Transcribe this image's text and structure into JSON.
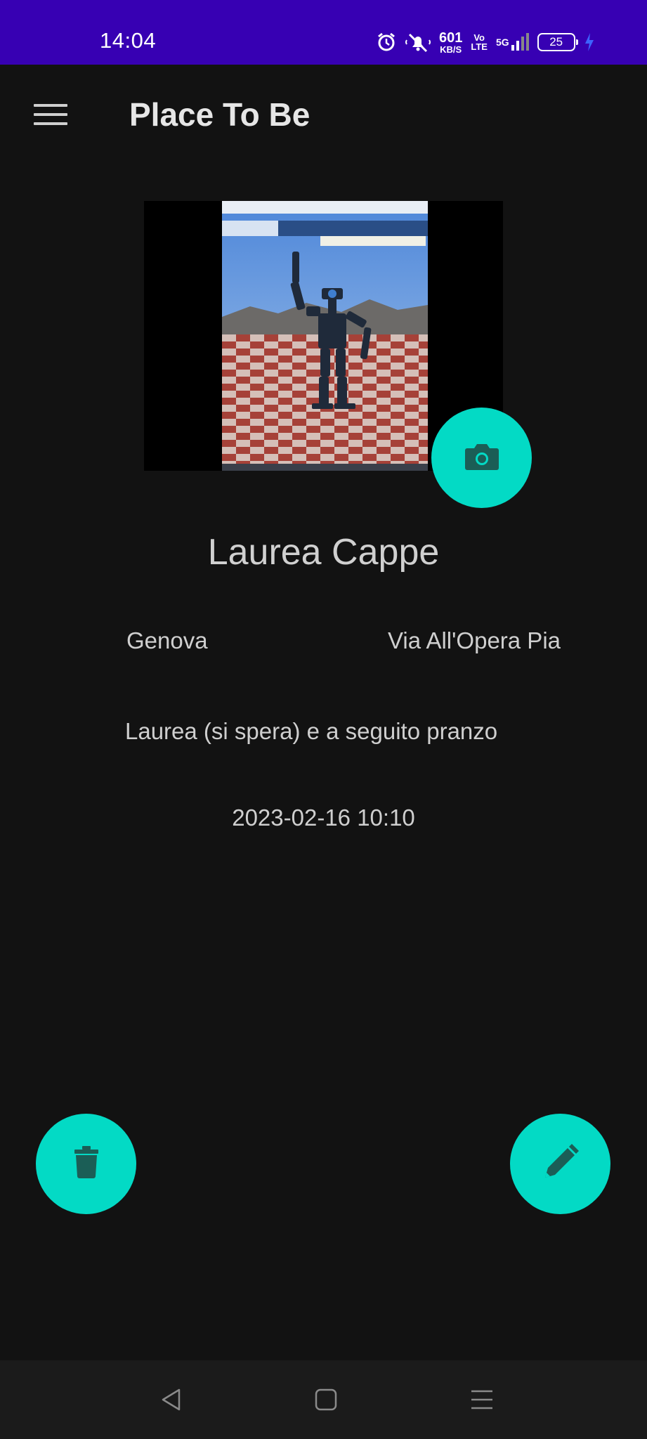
{
  "status_bar": {
    "time": "14:04",
    "network_speed_value": "601",
    "network_speed_unit": "KB/S",
    "volte_top": "Vo",
    "volte_bottom": "LTE",
    "network_type": "5G",
    "battery_level": "25",
    "icons": [
      "alarm-icon",
      "mute-icon",
      "volte-icon",
      "signal-icon",
      "battery-icon",
      "charging-icon"
    ]
  },
  "app_bar": {
    "title": "Place To Be",
    "menu_icon": "menu-icon"
  },
  "place": {
    "name": "Laurea Cappe",
    "city": "Genova",
    "street": "Via All'Opera Pia",
    "description": "Laurea (si spera) e a seguito pranzo",
    "datetime": "2023-02-16 10:10"
  },
  "actions": {
    "camera_icon": "camera-icon",
    "delete_icon": "trash-icon",
    "edit_icon": "pencil-icon"
  },
  "nav_bar": {
    "icons": [
      "back-icon",
      "home-icon",
      "recents-icon"
    ]
  },
  "colors": {
    "status_bar": "#3700b3",
    "background": "#121212",
    "accent": "#03dac5",
    "text": "#cfcfcf"
  }
}
